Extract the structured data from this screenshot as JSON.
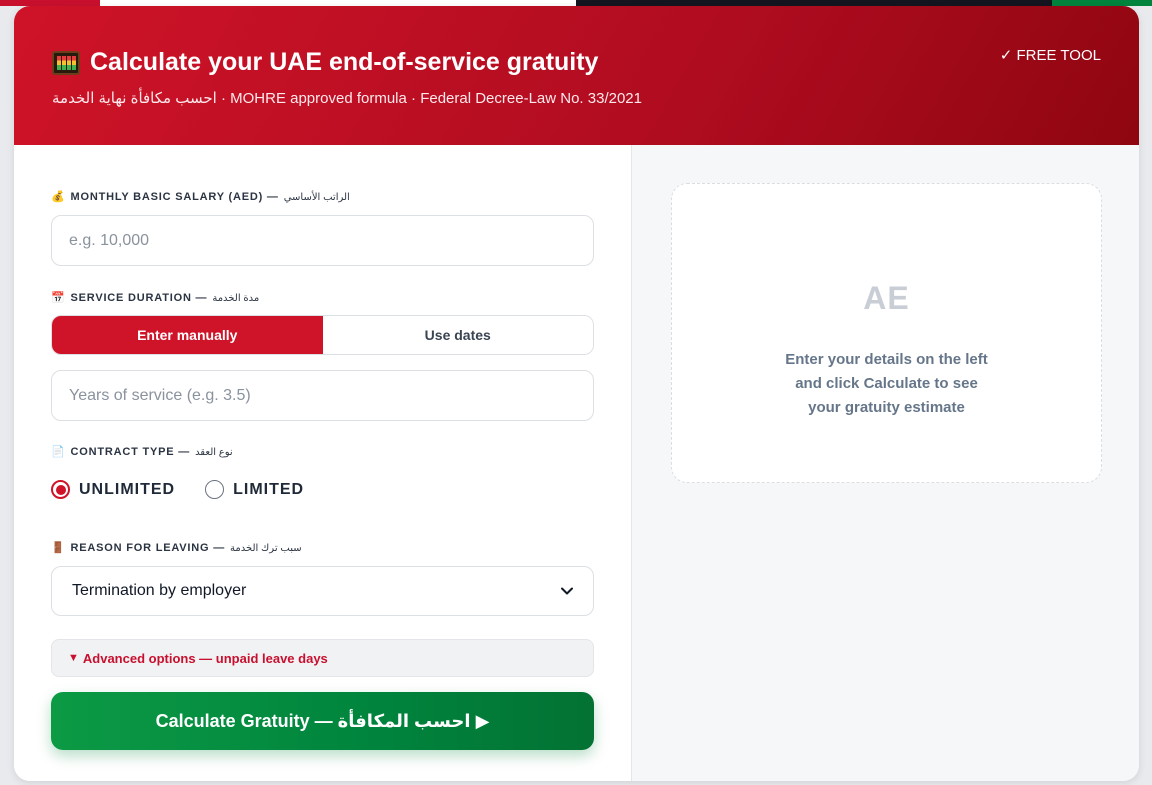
{
  "colors": {
    "primary_red": "#cf1328",
    "accent_green": "#00843d",
    "flag_black": "#15151f",
    "flag_white": "#ffffff"
  },
  "header": {
    "icon": "abacus-icon",
    "title": "Calculate your UAE end-of-service gratuity",
    "subtitle": "احسب مكافأة نهاية الخدمة · MOHRE approved formula · Federal Decree-Law No. 33/2021",
    "badge": "✓ FREE TOOL"
  },
  "form": {
    "salary": {
      "icon": "money-bag-icon",
      "label": "Monthly basic salary (AED) —",
      "label_ar": "الراتب الأساسي",
      "placeholder": "e.g. 10,000",
      "value": ""
    },
    "duration": {
      "icon": "calendar-icon",
      "label": "Service duration —",
      "label_ar": "مدة الخدمة",
      "mode_manual": "Enter manually",
      "mode_dates": "Use dates",
      "selected_mode": "Enter manually",
      "placeholder": "Years of service (e.g. 3.5)",
      "value": ""
    },
    "contract": {
      "icon": "document-icon",
      "label": "Contract type —",
      "label_ar": "نوع العقد",
      "option_unlimited": "UNLIMITED",
      "option_limited": "LIMITED",
      "selected": "UNLIMITED"
    },
    "reason": {
      "icon": "door-icon",
      "label": "Reason for leaving —",
      "label_ar": "سبب ترك الخدمة",
      "selected": "Termination by employer"
    },
    "advanced_label": "Advanced options — unpaid leave days",
    "calculate_button": "Calculate Gratuity — احسب المكافأة ▶"
  },
  "results": {
    "logo_text": "AE",
    "hint_line1": "Enter your details on the left",
    "hint_line2": "and click Calculate to see",
    "hint_line3": "your gratuity estimate"
  }
}
